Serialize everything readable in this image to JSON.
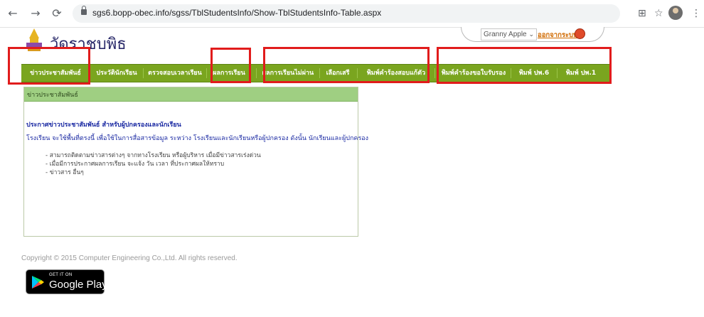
{
  "browser": {
    "url": "sgs6.bopp-obec.info/sgss/TblStudentsInfo/Show-TblStudentsInfo-Table.aspx",
    "back_icon": "arrow-left-icon",
    "forward_icon": "arrow-right-icon",
    "reload_icon": "reload-icon",
    "lock_icon": "lock-icon",
    "translate_icon": "translate-icon",
    "star_icon": "star-icon",
    "menu_icon": "kebab-menu-icon"
  },
  "header": {
    "site_title": "วัดราชบพิธ",
    "user_select_value": "Granny Apple",
    "logout_label": "ออกจากระบบ"
  },
  "nav": {
    "items": [
      "ข่าวประชาสัมพันธ์",
      "ประวัตินักเรียน",
      "ตรวจสอบเวลาเรียน",
      "ผลการเรียน",
      "ผลการเรียนไม่ผ่าน",
      "เลือกเสรี",
      "พิมพ์คำร้องสอบแก้ตัว",
      "พิมพ์คำร้องขอใบรับรอง",
      "พิมพ์ ปพ.6",
      "พิมพ์ ปพ.1"
    ]
  },
  "panel": {
    "heading": "ข่าวประชาสัมพันธ์",
    "news_title": "ประกาศข่าวประชาสัมพันธ์ สำหรับผู้ปกครองและนักเรียน",
    "news_body": "โรงเรียน จะใช้พื้นที่ตรงนี้ เพื่อใช้ในการสื่อสารข้อมูล ระหว่าง โรงเรียนและนักเรียนหรือผู้ปกครอง ดังนั้น นักเรียนและผู้ปกครอง",
    "bullets": [
      "- สามารถติดตามข่าวสารต่างๆ จากทางโรงเรียน หรือผู้บริหาร เมื่อมีข่าวสารเร่งด่วน",
      "- เมื่อมีการประกาศผลการเรียน จะแจ้ง วัน เวลา ที่ประกาศผลให้ทราบ",
      "- ข่าวสาร อื่นๆ"
    ]
  },
  "footer": {
    "copyright": "Copyright © 2015 Computer Engineering Co.,Ltd. All rights reserved.",
    "store_small": "GET IT ON",
    "store_big": "Google Play"
  },
  "colors": {
    "nav_green": "#7aa51f",
    "highlight_red": "#e11c1c",
    "panel_header": "#9fcf82",
    "news_blue": "#1b2aa3"
  }
}
